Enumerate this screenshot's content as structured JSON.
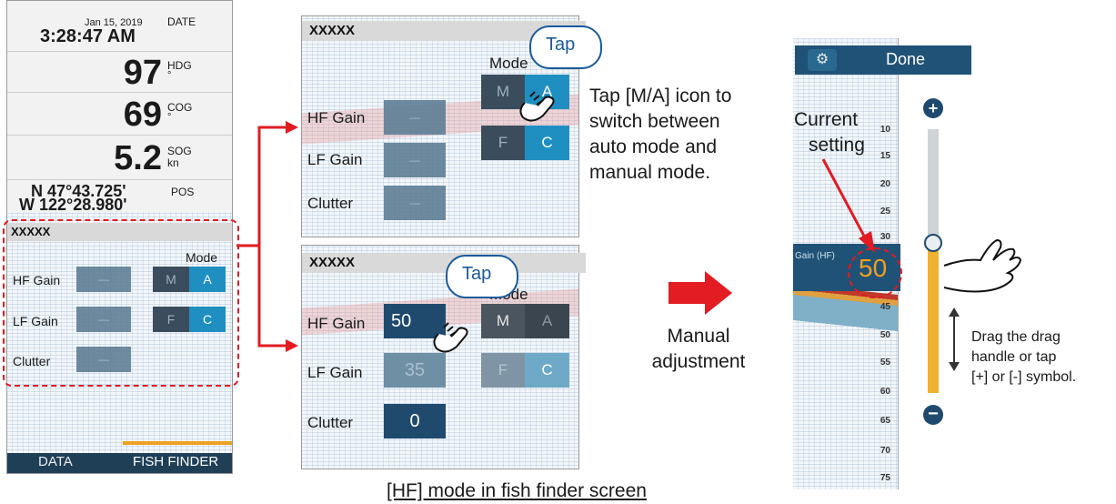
{
  "left_panel": {
    "date": "Jan 15, 2019",
    "time": "3:28:47 AM",
    "date_label": "DATE",
    "hdg_value": "97",
    "hdg_label": "HDG",
    "deg": "°",
    "cog_value": "69",
    "cog_label": "COG",
    "sog_value": "5.2",
    "sog_label": "SOG",
    "sog_unit": "kn",
    "lat": "N 47°43.725'",
    "lon": "W 122°28.980'",
    "pos_label": "POS",
    "popup_title": "XXXXX",
    "mode_label": "Mode",
    "hf_gain": "HF Gain",
    "lf_gain": "LF Gain",
    "clutter": "Clutter",
    "dash": "—",
    "m": "M",
    "a": "A",
    "f": "F",
    "c": "C",
    "tab_data": "DATA",
    "tab_fish": "FISH FINDER"
  },
  "panel_top": {
    "title": "XXXXX",
    "mode_label": "Mode",
    "hf_gain": "HF Gain",
    "lf_gain": "LF Gain",
    "clutter": "Clutter",
    "dash": "—",
    "m": "M",
    "a": "A",
    "f": "F",
    "c": "C",
    "tap": "Tap"
  },
  "panel_bottom": {
    "title": "XXXXX",
    "mode_label": "Mode",
    "hf_gain": "HF Gain",
    "lf_gain": "LF Gain",
    "clutter": "Clutter",
    "hf_value": "50",
    "lf_value": "35",
    "clutter_value": "0",
    "m": "M",
    "a": "A",
    "f": "F",
    "c": "C",
    "tap": "Tap"
  },
  "callouts": {
    "tap_ma_l1": "Tap [M/A] icon to",
    "tap_ma_l2": "switch between",
    "tap_ma_l3": "auto mode and",
    "tap_ma_l4": "manual mode.",
    "manual_l1": "Manual",
    "manual_l2": "adjustment",
    "current_l1": "Current",
    "current_l2": "setting",
    "drag_l1": "Drag the drag",
    "drag_l2": "handle or tap",
    "drag_l3": "[+] or [-] symbol.",
    "caption": "[HF] mode in fish finder screen"
  },
  "slider_panel": {
    "done": "Done",
    "gain_label": "Gain (HF)",
    "value": "50",
    "level_percent": 57,
    "ticks": [
      "10",
      "15",
      "20",
      "25",
      "30",
      "45",
      "50",
      "55",
      "60",
      "65",
      "70",
      "75"
    ]
  }
}
